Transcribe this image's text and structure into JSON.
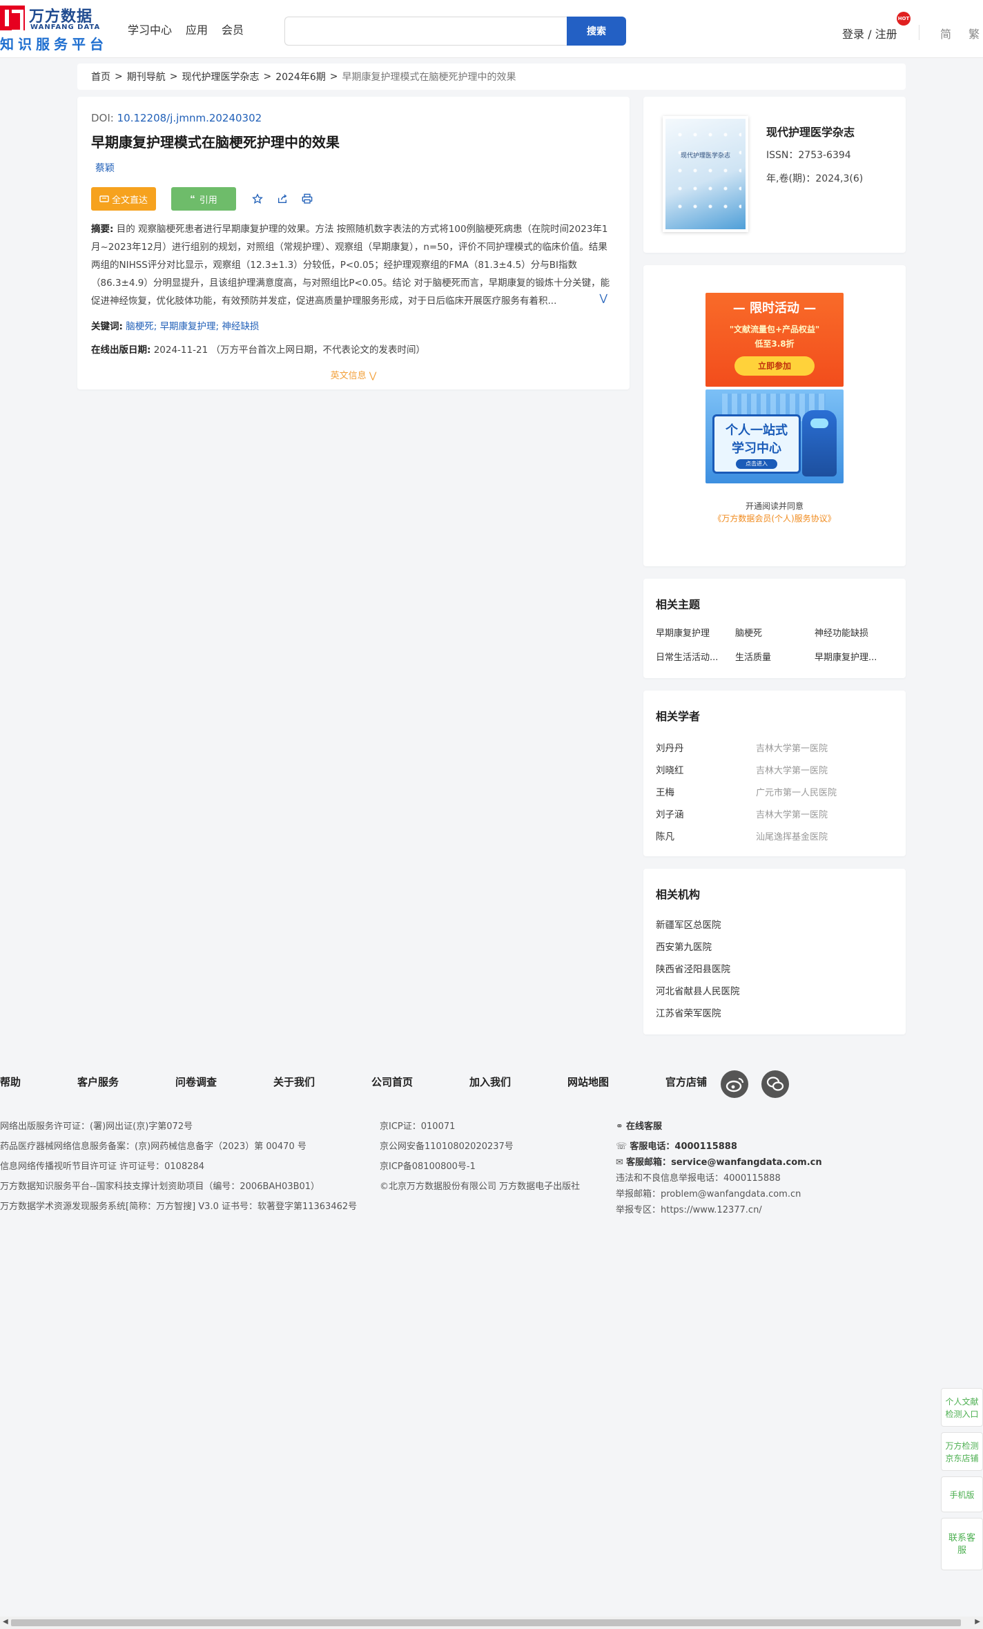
{
  "header": {
    "logo_cn": "万方数据",
    "logo_en": "WANFANG DATA",
    "logo_sub": "知识服务平台",
    "nav": [
      "学习中心",
      "应用",
      "会员"
    ],
    "search_placeholder": "",
    "search_button": "搜索",
    "login": "登录 / 注册",
    "hot_badge": "HOT",
    "lang_simplified": "简",
    "lang_traditional": "繁"
  },
  "breadcrumb": [
    "首页",
    "期刊导航",
    "现代护理医学杂志",
    "2024年6期"
  ],
  "breadcrumb_current": "早期康复护理模式在脑梗死护理中的效果",
  "article": {
    "doi_label": "DOI: ",
    "doi": "10.12208/j.jmnm.20240302",
    "title": "早期康复护理模式在脑梗死护理中的效果",
    "author": "蔡颖",
    "btn_full": "全文直达",
    "btn_cite": "引用",
    "abstract_label": "摘要:",
    "abstract": " 目的 观察脑梗死患者进行早期康复护理的效果。方法 按照随机数字表法的方式将100例脑梗死病患（在院时间2023年1月~2023年12月）进行组别的规划，对照组（常规护理）、观察组（早期康复），n=50，评价不同护理模式的临床价值。结果 两组的NIHSS评分对比显示，观察组（12.3±1.3）分较低，P<0.05；经护理观察组的FMA（81.3±4.5）分与BI指数（86.3±4.9）分明显提升，且该组护理满意度高，与对照组比P<0.05。结论 对于脑梗死而言，早期康复的锻炼十分关键，能促进神经恢复，优化肢体功能，有效预防并发症，促进高质量护理服务形成，对于日后临床开展医疗服务有着积...",
    "keywords_label": "关键词:",
    "keywords": [
      "脑梗死;",
      "早期康复护理;",
      "神经缺损"
    ],
    "date_label": "在线出版日期:",
    "date": "2024-11-21",
    "date_note": "（万方平台首次上网日期，不代表论文的发表时间）",
    "en_info": "英文信息"
  },
  "journal": {
    "cover_title": "现代护理医学杂志",
    "name": "现代护理医学杂志",
    "issn": "ISSN：2753-6394",
    "volume": "年,卷(期)：2024,3(6)"
  },
  "promo": {
    "tag": "限时活动",
    "line1": "\"文献流量包+产品权益\"",
    "line2": "低至3.8折",
    "button": "立即参加",
    "board_t1": "个人一站式",
    "board_t2": "学习中心",
    "board_btn": "点击进入",
    "text1": "开通阅读并同意",
    "text2": "《万方数据会员(个人)服务协议》"
  },
  "topics": {
    "title": "相关主题",
    "items": [
      "早期康复护理",
      "脑梗死",
      "神经功能缺损",
      "日常生活活动...",
      "生活质量",
      "早期康复护理..."
    ]
  },
  "scholars": {
    "title": "相关学者",
    "items": [
      {
        "name": "刘丹丹",
        "org": "吉林大学第一医院"
      },
      {
        "name": "刘晓红",
        "org": "吉林大学第一医院"
      },
      {
        "name": "王梅",
        "org": "广元市第一人民医院"
      },
      {
        "name": "刘子涵",
        "org": "吉林大学第一医院"
      },
      {
        "name": "陈凡",
        "org": "汕尾逸挥基金医院"
      }
    ]
  },
  "institutions": {
    "title": "相关机构",
    "items": [
      "新疆军区总医院",
      "西安第九医院",
      "陕西省泾阳县医院",
      "河北省献县人民医院",
      "江苏省荣军医院"
    ]
  },
  "footer": {
    "links": [
      "帮助",
      "客户服务",
      "问卷调查",
      "关于我们",
      "公司首页",
      "加入我们",
      "网站地图",
      "官方店铺"
    ],
    "col1": [
      "网络出版服务许可证：(署)网出证(京)字第072号",
      "药品医疗器械网络信息服务备案：(京)网药械信息备字（2023）第 00470 号",
      "信息网络传播视听节目许可证 许可证号：0108284",
      "万方数据知识服务平台--国家科技支撑计划资助项目（编号：2006BAH03B01）",
      "万方数据学术资源发现服务系统[简称：万方智搜] V3.0 证书号：软著登字第11363462号"
    ],
    "col2": [
      "京ICP证：010071",
      "京公网安备11010802020237号",
      "京ICP备08100800号-1",
      "©北京万方数据股份有限公司 万方数据电子出版社"
    ],
    "online_service": "在线客服",
    "phone_label": "客服电话：",
    "phone": "4000115888",
    "email_label": "客服邮箱：",
    "email": "service@wanfangdata.com.cn",
    "report_phone": "违法和不良信息举报电话：4000115888",
    "report_email": "举报邮箱：problem@wanfangdata.com.cn",
    "report_area": "举报专区：https://www.12377.cn/"
  },
  "float": [
    "个人文献检测入口",
    "万方检测京东店铺",
    "手机版",
    "联系客服"
  ]
}
